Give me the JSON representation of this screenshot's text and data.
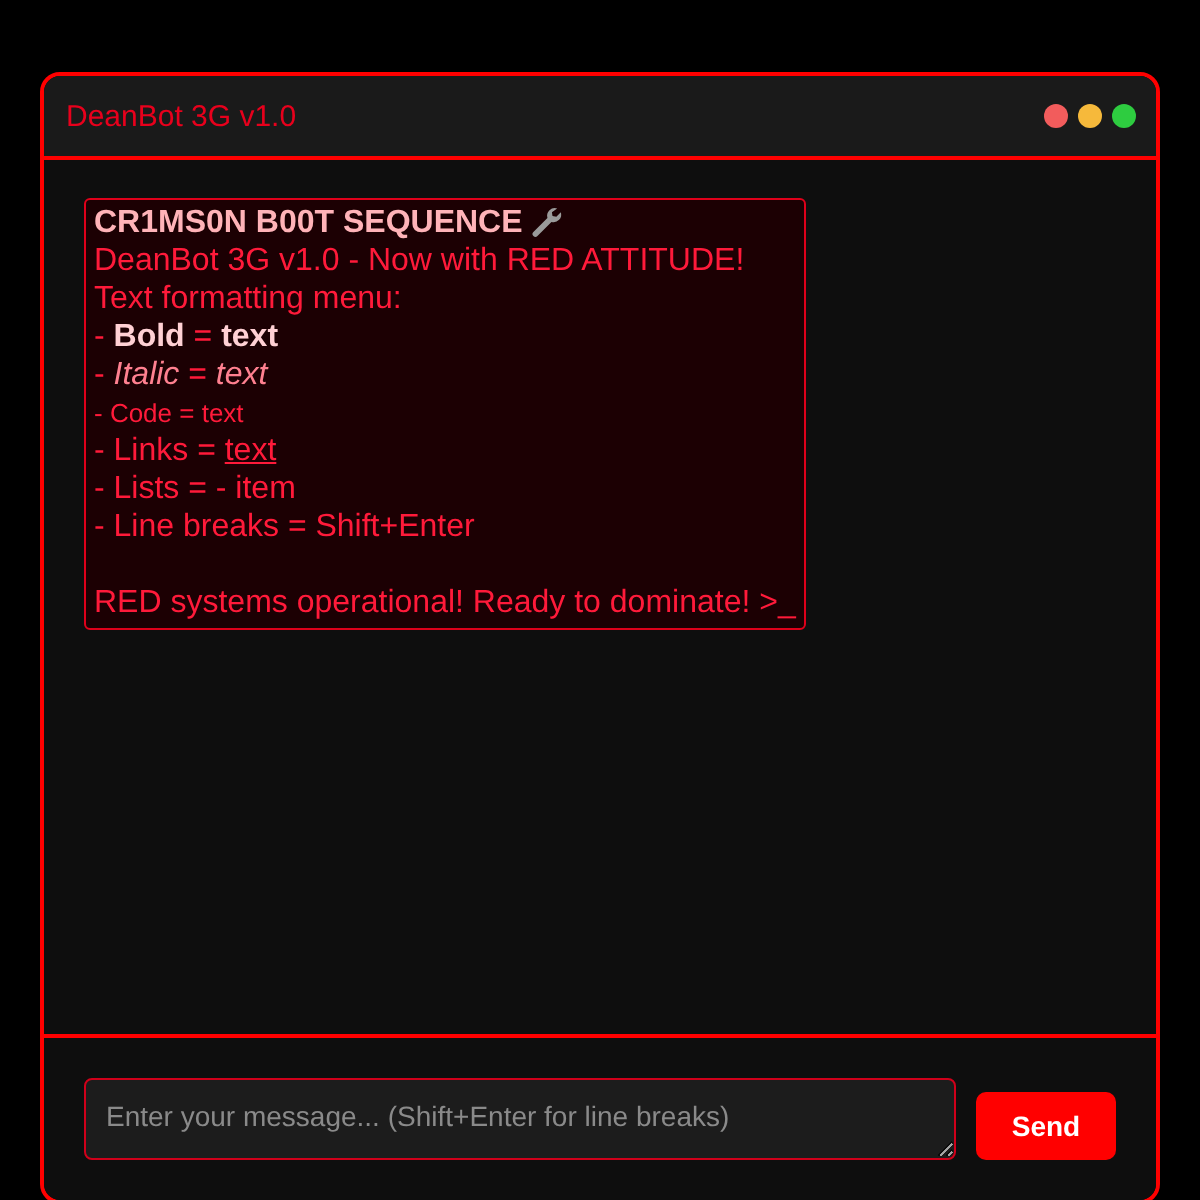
{
  "window": {
    "title": "DeanBot 3G v1.0",
    "controls": [
      {
        "color": "#f25c5c"
      },
      {
        "color": "#f6b93b"
      },
      {
        "color": "#2ecc40"
      }
    ]
  },
  "messages": [
    {
      "paragraphs": [
        [
          {
            "kind": "heading",
            "text": "CR1MS0N B00T SEQUENCE"
          },
          {
            "kind": "plain",
            "text": "DeanBot 3G v1.0 - Now with RED ATTITUDE!"
          },
          {
            "kind": "plain",
            "text": "Text formatting menu:"
          },
          {
            "kind": "plain",
            "text": "- **Bold** = **text**"
          },
          {
            "kind": "plain",
            "text": "- *Italic* = *text*"
          },
          {
            "kind": "code",
            "text": "- Code = text"
          },
          {
            "kind": "link",
            "text": "- Links = ",
            "link": "text"
          },
          {
            "kind": "plain",
            "text": "- Lists = - item"
          },
          {
            "kind": "plain",
            "text": "- Line breaks = Shift+Enter"
          }
        ],
        [
          {
            "kind": "plain",
            "text": "RED systems operational! Ready to dominate! >_"
          }
        ]
      ]
    }
  ],
  "composer": {
    "placeholder": "Enter your message... (Shift+Enter for line breaks)",
    "send_button": "Send"
  }
}
